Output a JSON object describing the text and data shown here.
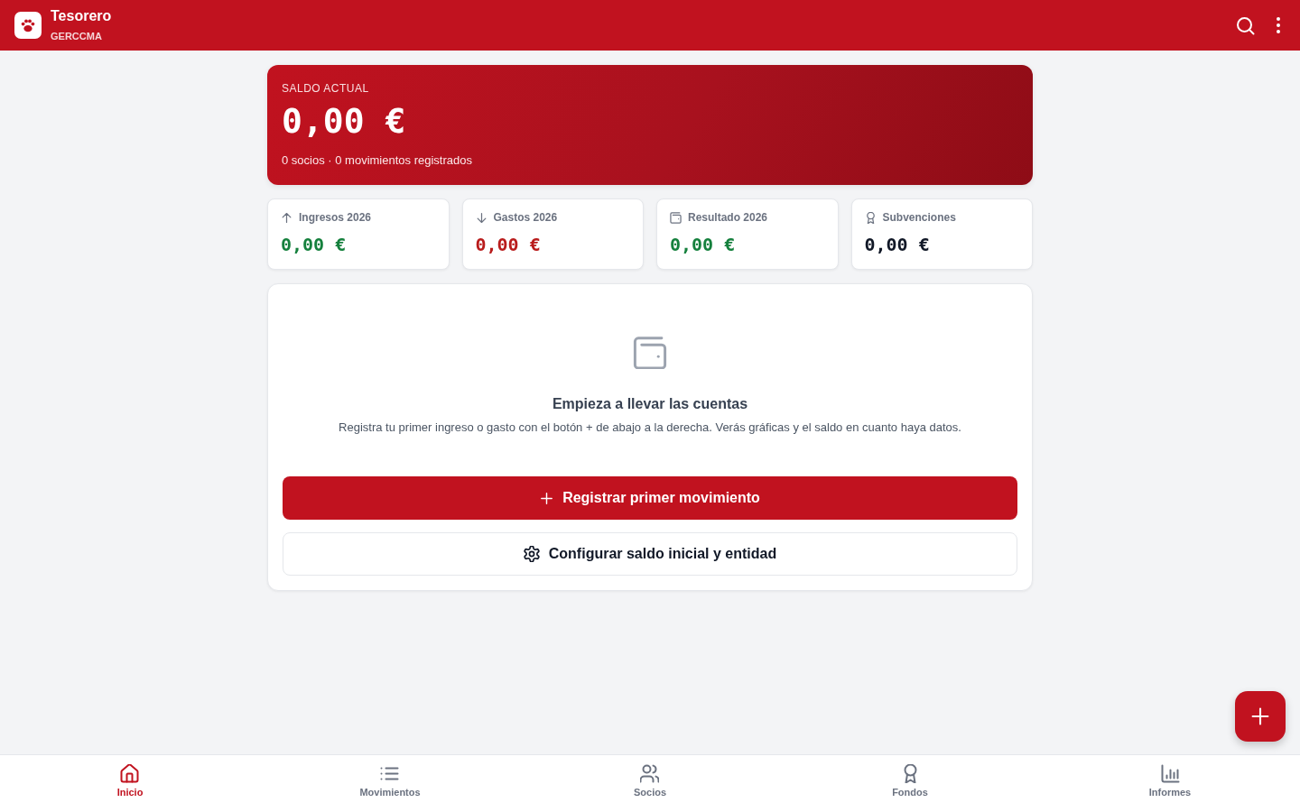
{
  "app_bar": {
    "title": "Tesorero",
    "subtitle": "GERCCMA"
  },
  "balance": {
    "label": "SALDO ACTUAL",
    "amount": "0,00 €",
    "summary": "0 socios · 0 movimientos registrados"
  },
  "stats": [
    {
      "kind": "income",
      "label": "Ingresos 2026",
      "amount": "0,00 €",
      "color": "#15803d"
    },
    {
      "kind": "expense",
      "label": "Gastos 2026",
      "amount": "0,00 €",
      "color": "#b91c1c"
    },
    {
      "kind": "result",
      "label": "Resultado 2026",
      "amount": "0,00 €",
      "color": "#15803d"
    },
    {
      "kind": "grants",
      "label": "Subvenciones",
      "amount": "0,00 €",
      "color": "#111827"
    }
  ],
  "empty_state": {
    "title": "Empieza a llevar las cuentas",
    "description": "Registra tu primer ingreso o gasto con el botón + de abajo a la derecha. Verás gráficas y el saldo en cuanto haya datos.",
    "actions": [
      {
        "kind": "primary",
        "label": "Registrar primer movimiento"
      },
      {
        "kind": "secondary",
        "label": "Configurar saldo inicial y entidad"
      }
    ]
  },
  "bottom_nav": [
    {
      "kind": "home",
      "label": "Inicio",
      "selected": true
    },
    {
      "kind": "list",
      "label": "Movimientos",
      "selected": false
    },
    {
      "kind": "people",
      "label": "Socios",
      "selected": false
    },
    {
      "kind": "award",
      "label": "Fondos",
      "selected": false
    },
    {
      "kind": "chart",
      "label": "Informes",
      "selected": false
    }
  ]
}
